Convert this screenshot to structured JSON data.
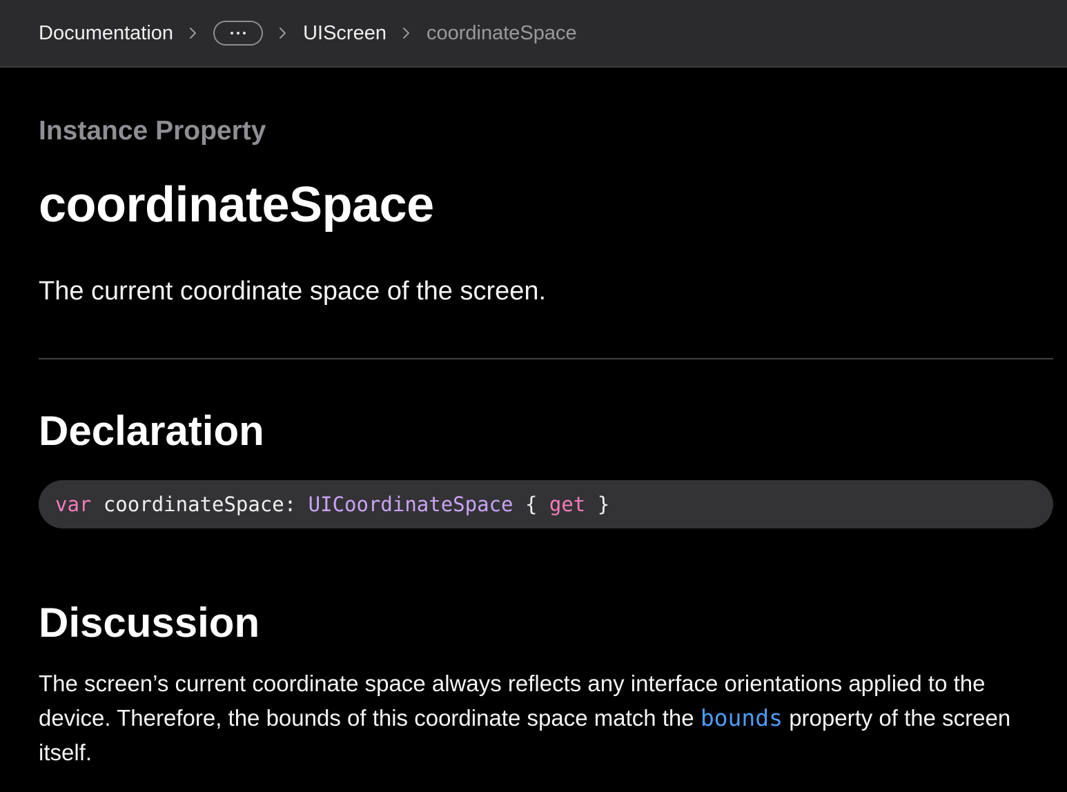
{
  "breadcrumb": {
    "items": [
      {
        "label": "Documentation"
      },
      {
        "label": "UIScreen"
      },
      {
        "label": "coordinateSpace"
      }
    ],
    "more_icon": "ellipsis-icon"
  },
  "page": {
    "eyebrow": "Instance Property",
    "title": "coordinateSpace",
    "abstract": "The current coordinate space of the screen."
  },
  "declaration": {
    "heading": "Declaration",
    "code": {
      "keyword": "var",
      "name": " coordinateSpace: ",
      "type": "UICoordinateSpace",
      "open": " { ",
      "accessor": "get",
      "close": " }"
    }
  },
  "discussion": {
    "heading": "Discussion",
    "text_before": "The screen’s current coordinate space always reflects any interface orientations applied to the device. Therefore, the bounds of this coordinate space match the ",
    "link": "bounds",
    "text_after": " property of the screen itself."
  },
  "colors": {
    "nav_bg": "#2b2b2d",
    "page_bg": "#000000",
    "code_bg": "#333336",
    "keyword": "#f47cb8",
    "type": "#c9a4f3",
    "link": "#4d9cf5"
  }
}
